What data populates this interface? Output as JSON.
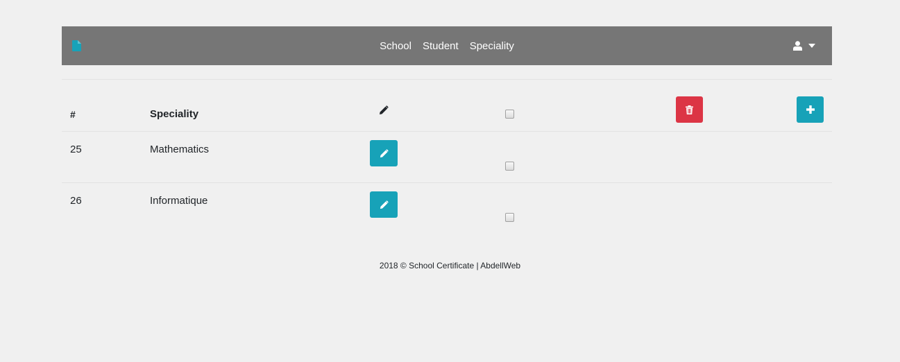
{
  "nav": {
    "brand_icon": "file-icon",
    "links": [
      "School",
      "Student",
      "Speciality"
    ],
    "user_icon": "user-icon",
    "dropdown_icon": "caret-down-icon",
    "bg_color": "#767676",
    "brand_color": "#17a2b8"
  },
  "table": {
    "headers": {
      "num": "#",
      "speciality": "Speciality",
      "edit_icon": "pencil-icon",
      "delete_icon": "trash-icon",
      "add_icon": "plus-icon"
    },
    "rows": [
      {
        "id": "25",
        "speciality": "Mathematics"
      },
      {
        "id": "26",
        "speciality": "Informatique"
      }
    ]
  },
  "colors": {
    "info": "#17a2b8",
    "danger": "#dc3545"
  },
  "footer": {
    "text": "2018 © School Certificate | AbdellWeb"
  }
}
